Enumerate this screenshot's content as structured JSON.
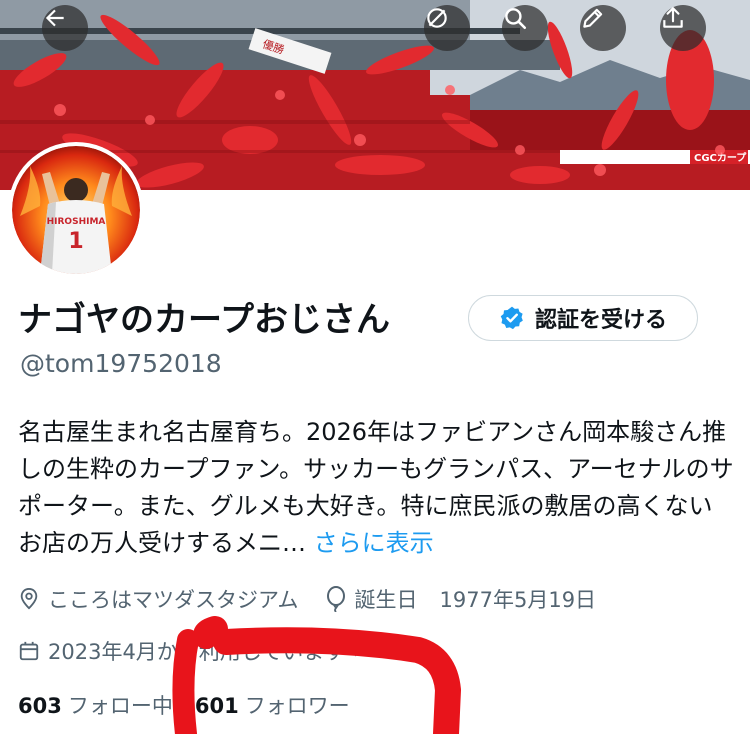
{
  "banner": {
    "sign_texts": [
      "優勝",
      "CGCカープ"
    ]
  },
  "header": {
    "back_icon": "arrow-left-icon",
    "mute_icon": "slashed-circle-icon",
    "search_icon": "search-icon",
    "edit_icon": "pencil-icon",
    "share_icon": "share-upload-icon"
  },
  "avatar": {
    "jersey_name": "HIROSHIMA",
    "jersey_number": "1"
  },
  "profile": {
    "display_name": "ナゴヤのカープおじさん",
    "verify_label": "認証を受ける",
    "handle": "@tom19752018",
    "bio": "名古屋生まれ名古屋育ち。2026年はファビアンさん岡本駿さん推しの生粋のカープファン。サッカーもグランパス、アーセナルのサポーター。また、グルメも大好き。特に庶民派の敷居の高くないお店の万人受けするメニ…",
    "more_label": "さらに表示",
    "location": "こころはマツダスタジアム",
    "birthday_label": "誕生日",
    "birthday": "1977年5月19日",
    "joined": "2023年4月から利用しています",
    "following_count": "603",
    "following_label": "フォロー中",
    "followers_count": "601",
    "followers_label": "フォロワー"
  },
  "colors": {
    "accent": "#1d9bf0",
    "secondary_text": "#536471",
    "annotation_red": "#e8141b",
    "carp_red": "#c8242b"
  }
}
